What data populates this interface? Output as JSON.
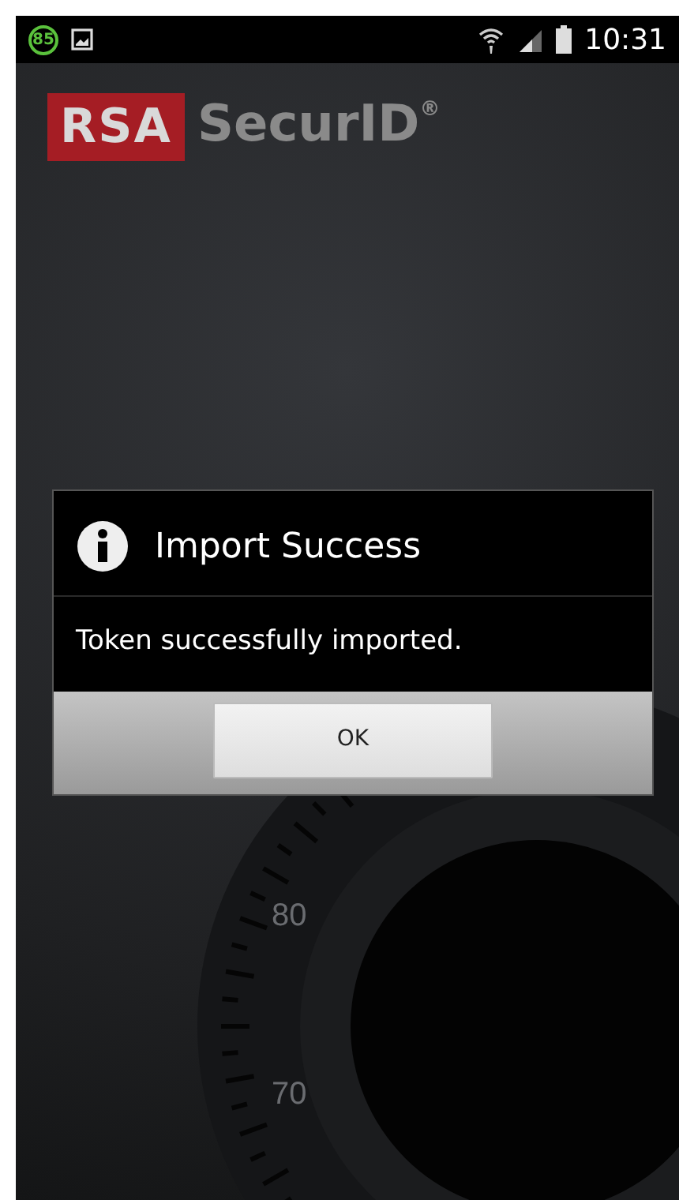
{
  "status_bar": {
    "notification_badge": "85",
    "time": "10:31"
  },
  "logo": {
    "brand": "RSA",
    "product": "SecurID$^{®}$"
  },
  "background": {
    "dial_labels": [
      "80",
      "70"
    ]
  },
  "dialog": {
    "title": "Import Success",
    "message": "Token successfully imported.",
    "buttons": [
      "OK"
    ]
  }
}
